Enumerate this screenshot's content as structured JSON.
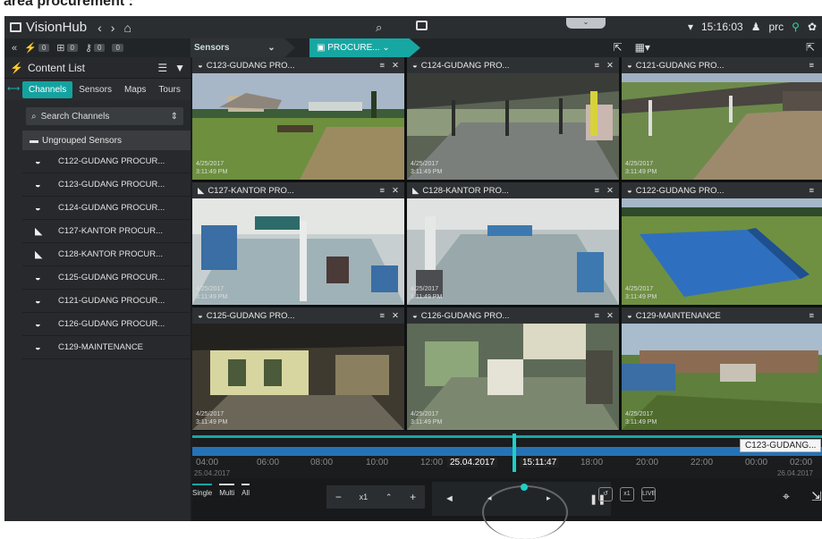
{
  "page": {
    "caption_fragment": "area procurement :"
  },
  "app": {
    "title": "VisionHub",
    "time": "15:16:03",
    "user": "prc"
  },
  "toolbar": {
    "counts": [
      "0",
      "0",
      "0",
      "0"
    ],
    "crumb1": "Sensors",
    "crumb2": "PROCURE..."
  },
  "sidebar": {
    "title": "Content List",
    "tabs": [
      "Channels",
      "Sensors",
      "Maps",
      "Tours"
    ],
    "search_placeholder": "Search Channels",
    "group": "Ungrouped Sensors",
    "items": [
      "C122-GUDANG PROCUR...",
      "C123-GUDANG PROCUR...",
      "C124-GUDANG PROCUR...",
      "C127-KANTOR PROCUR...",
      "C128-KANTOR PROCUR...",
      "C125-GUDANG PROCUR...",
      "C121-GUDANG PROCUR...",
      "C126-GUDANG PROCUR...",
      "C129-MAINTENANCE"
    ]
  },
  "tiles": [
    {
      "title": "C123-GUDANG PRO...",
      "date": "4/25/2017",
      "time": "3:11:49 PM"
    },
    {
      "title": "C124-GUDANG PRO...",
      "date": "4/25/2017",
      "time": "3:11:49 PM"
    },
    {
      "title": "C121-GUDANG PRO...",
      "date": "4/25/2017",
      "time": "3:11:49 PM"
    },
    {
      "title": "C127-KANTOR PRO...",
      "date": "4/25/2017",
      "time": "3:11:49 PM"
    },
    {
      "title": "C128-KANTOR PRO...",
      "date": "4/25/2017",
      "time": "3:11:49 PM"
    },
    {
      "title": "C122-GUDANG PRO...",
      "date": "4/25/2017",
      "time": "3:11:49 PM"
    },
    {
      "title": "C125-GUDANG PRO...",
      "date": "4/25/2017",
      "time": "3:11:49 PM"
    },
    {
      "title": "C126-GUDANG PRO...",
      "date": "4/25/2017",
      "time": "3:11:49 PM"
    },
    {
      "title": "C129-MAINTENANCE",
      "date": "4/25/2017",
      "time": "3:11:49 PM"
    }
  ],
  "timeline": {
    "tooltip": "C123-GUDANG...",
    "ticks": [
      "04:00",
      "06:00",
      "08:00",
      "10:00",
      "12:00",
      "18:00",
      "20:00",
      "22:00",
      "00:00",
      "02:00"
    ],
    "current_date": "25.04.2017",
    "current_time": "15:11:47",
    "date_left": "25.04.2017",
    "date_right": "26.04.2017"
  },
  "bottom": {
    "modes": [
      "Single",
      "Multi",
      "All"
    ],
    "speed": "x1"
  }
}
